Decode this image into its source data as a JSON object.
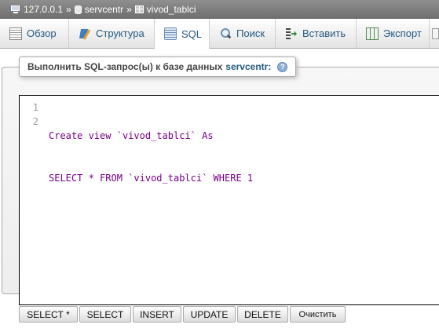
{
  "breadcrumb": {
    "server": "127.0.0.1",
    "database": "servcentr",
    "table": "vivod_tablci",
    "separator": "»"
  },
  "tabs": [
    {
      "label": "Обзор",
      "icon": "browse-icon"
    },
    {
      "label": "Структура",
      "icon": "structure-icon"
    },
    {
      "label": "SQL",
      "icon": "sql-icon",
      "active": true
    },
    {
      "label": "Поиск",
      "icon": "search-icon"
    },
    {
      "label": "Вставить",
      "icon": "insert-icon"
    },
    {
      "label": "Экспорт",
      "icon": "export-icon"
    }
  ],
  "query_box": {
    "legend_prefix": "Выполнить SQL-запрос(ы) к базе данных",
    "database": "servcentr:",
    "help": "?"
  },
  "editor": {
    "line_numbers": [
      "1",
      "2"
    ],
    "lines": [
      {
        "p1": "Create",
        "p2": " view ",
        "p3": "`vivod_tablci`",
        "p4": " As"
      },
      {
        "p1": "SELECT",
        "p2": " * ",
        "p3": "FROM",
        "p4": " `vivod_tablci` ",
        "p5": "WHERE",
        "p6": " 1"
      }
    ]
  },
  "buttons": {
    "select_all": "SELECT *",
    "select": "SELECT",
    "insert": "INSERT",
    "update": "UPDATE",
    "delete": "DELETE",
    "clear": "Очистить"
  },
  "colors": {
    "breadcrumb_bg": "#7f7f7f",
    "tab_text": "#235a81",
    "sql_keyword": "#770088",
    "sql_number": "#116644"
  }
}
